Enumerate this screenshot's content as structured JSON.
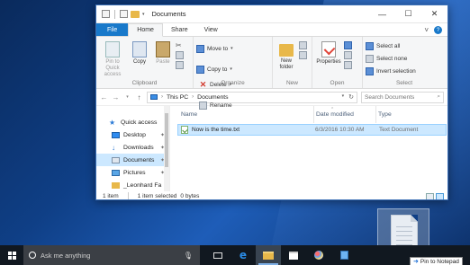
{
  "window": {
    "title": "Documents",
    "controls": {
      "minimize": "—",
      "maximize": "☐",
      "close": "✕"
    }
  },
  "ribbon": {
    "tabs": [
      "File",
      "Home",
      "Share",
      "View"
    ],
    "active_tab": "Home",
    "clipboard": {
      "label": "Clipboard",
      "pin": "Pin to Quick access",
      "copy": "Copy",
      "paste": "Paste"
    },
    "organize": {
      "label": "Organize",
      "move_to": "Move to",
      "copy_to": "Copy to",
      "delete": "Delete",
      "rename": "Rename"
    },
    "new": {
      "label": "New",
      "new_folder": "New folder"
    },
    "open": {
      "label": "Open",
      "properties": "Properties"
    },
    "select": {
      "label": "Select",
      "select_all": "Select all",
      "select_none": "Select none",
      "invert": "Invert selection"
    }
  },
  "address": {
    "crumbs": [
      "This PC",
      "Documents"
    ],
    "search_placeholder": "Search Documents"
  },
  "nav_pane": {
    "items": [
      {
        "label": "Quick access",
        "icon": "star-icon"
      },
      {
        "label": "Desktop",
        "icon": "desktop-icon"
      },
      {
        "label": "Downloads",
        "icon": "download-icon"
      },
      {
        "label": "Documents",
        "icon": "documents-icon"
      },
      {
        "label": "Pictures",
        "icon": "pictures-icon"
      },
      {
        "label": "_Leonhard Fa",
        "icon": "folder-icon"
      }
    ]
  },
  "columns": {
    "name": "Name",
    "date": "Date modified",
    "type": "Type"
  },
  "files": [
    {
      "name": "Now is the time.txt",
      "date": "6/3/2016 10:30 AM",
      "type": "Text Document"
    }
  ],
  "status": {
    "count": "1 item",
    "selected": "1 item selected",
    "size": "0 bytes"
  },
  "taskbar": {
    "search_placeholder": "Ask me anything"
  },
  "tooltip": {
    "text": "Pin to Notepad"
  },
  "colors": {
    "accent": "#1979ca",
    "selection": "#cce8ff",
    "taskbar": "#111820"
  }
}
